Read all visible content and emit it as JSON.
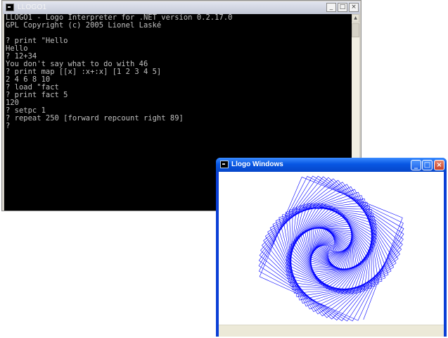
{
  "console": {
    "title": "LLOGO1",
    "controls": {
      "minimize": "_",
      "maximize": "□",
      "close": "×"
    },
    "lines": [
      "LLOGO1 - Logo Interpreter for .NET version 0.2.17.0",
      "GPL Copyright (c) 2005 Lionel Laské",
      "",
      "? print \"Hello",
      "Hello",
      "? 12+34",
      "You don't say what to do with 46",
      "? print map [[x] :x+:x] [1 2 3 4 5]",
      "2 4 6 8 10",
      "? load \"fact",
      "? print fact 5",
      "120",
      "? setpc 1",
      "? repeat 250 [forward repcount right 89]",
      "?"
    ],
    "text_color": "#c0c0c0",
    "background": "#000000"
  },
  "graphics_window": {
    "title": "Llogo Windows",
    "controls": {
      "minimize": "_",
      "maximize": "□",
      "close": "×"
    },
    "turtle_program": {
      "repeat": 250,
      "turn_degrees": 89,
      "pen_color": "#0000ff"
    }
  }
}
